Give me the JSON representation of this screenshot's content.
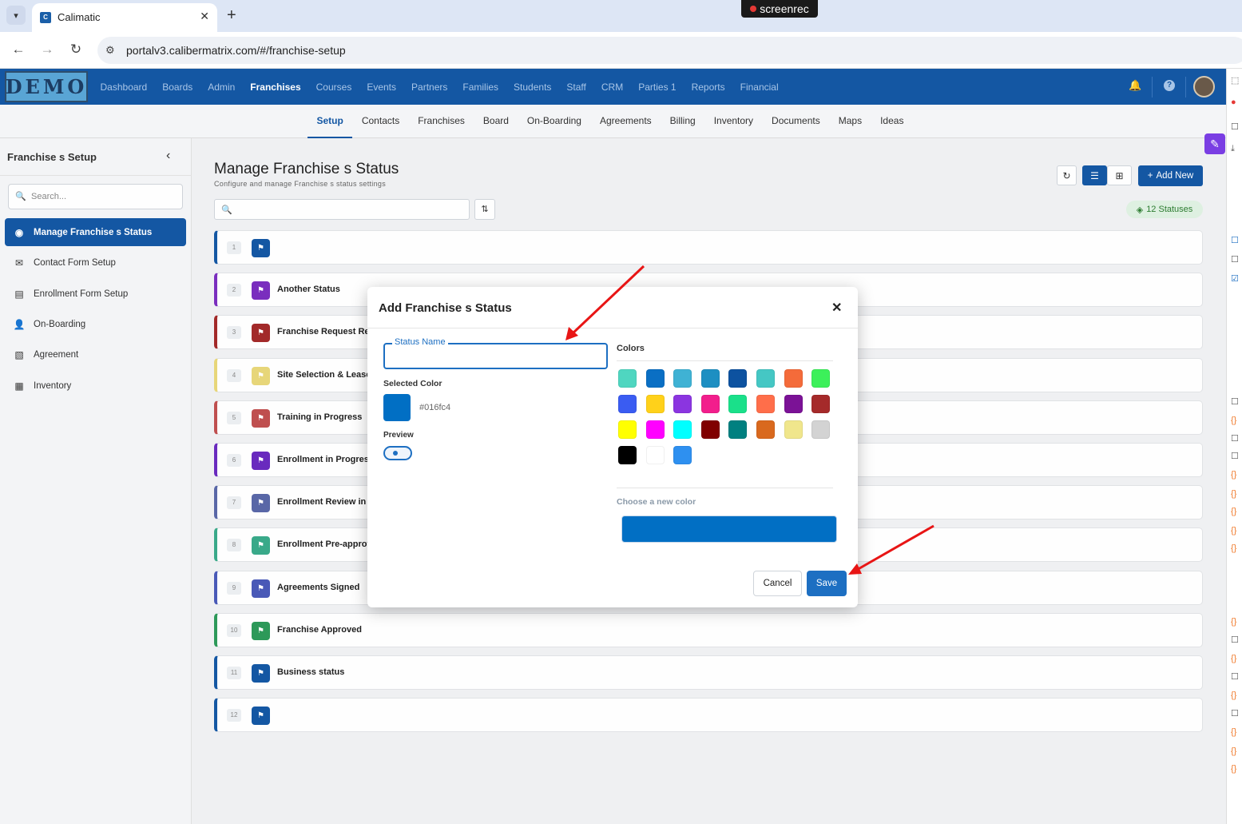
{
  "browser": {
    "tab_title": "Calimatic",
    "tab_close": "✕",
    "new_tab": "+",
    "url": "portalv3.calibermatrix.com/#/franchise-setup",
    "recorder": "screenrec"
  },
  "logo": "DEMO",
  "topnav": [
    "Dashboard",
    "Boards",
    "Admin",
    "Franchises",
    "Courses",
    "Events",
    "Partners",
    "Families",
    "Students",
    "Staff",
    "CRM",
    "Parties 1",
    "Reports",
    "Financial"
  ],
  "topnav_active": "Franchises",
  "subnav": [
    "Setup",
    "Contacts",
    "Franchises",
    "Board",
    "On-Boarding",
    "Agreements",
    "Billing",
    "Inventory",
    "Documents",
    "Maps",
    "Ideas"
  ],
  "subnav_active": "Setup",
  "sidebar": {
    "title": "Franchise s Setup",
    "search_placeholder": "Search...",
    "items": [
      {
        "label": "Manage Franchise s Status",
        "icon": "toggle-icon",
        "glyph": "◉"
      },
      {
        "label": "Contact Form Setup",
        "icon": "envelope-icon",
        "glyph": "✉"
      },
      {
        "label": "Enrollment Form Setup",
        "icon": "file-icon",
        "glyph": "▤"
      },
      {
        "label": "On-Boarding",
        "icon": "user-plus-icon",
        "glyph": "👤"
      },
      {
        "label": "Agreement",
        "icon": "file-chart-icon",
        "glyph": "▧"
      },
      {
        "label": "Inventory",
        "icon": "boxes-icon",
        "glyph": "▦"
      }
    ]
  },
  "page": {
    "title": "Manage Franchise s Status",
    "subtitle": "Configure and manage Franchise s status settings",
    "add_new": "Add New",
    "count_badge": "12 Statuses"
  },
  "statuses": [
    {
      "num": "1",
      "name": "",
      "color": "#1558a4"
    },
    {
      "num": "2",
      "name": "Another Status",
      "color": "#7b2fbf"
    },
    {
      "num": "3",
      "name": "Franchise Request Rec",
      "color": "#a32a2a"
    },
    {
      "num": "4",
      "name": "Site Selection & Lease",
      "color": "#e8d77a"
    },
    {
      "num": "5",
      "name": "Training in Progress",
      "color": "#c05050"
    },
    {
      "num": "6",
      "name": "Enrollment in Progress",
      "color": "#6a2bbf"
    },
    {
      "num": "7",
      "name": "Enrollment Review in F",
      "color": "#5a68a8"
    },
    {
      "num": "8",
      "name": "Enrollment Pre-approv",
      "color": "#3aaa8a"
    },
    {
      "num": "9",
      "name": "Agreements Signed",
      "color": "#4a5ab8"
    },
    {
      "num": "10",
      "name": "Franchise Approved",
      "color": "#2e9a5a"
    },
    {
      "num": "11",
      "name": "Business status",
      "color": "#1558a4"
    },
    {
      "num": "12",
      "name": "",
      "color": "#1558a4"
    }
  ],
  "modal": {
    "title": "Add Franchise s Status",
    "close": "✕",
    "status_name_label": "Status Name",
    "status_name_value": "",
    "selected_color_label": "Selected Color",
    "selected_color": "#016fc4",
    "preview_label": "Preview",
    "colors_label": "Colors",
    "palette": [
      "#4fd6c0",
      "#0a6fc4",
      "#3fb2d4",
      "#1d8fc2",
      "#0d52a0",
      "#45c7c4",
      "#f46b3a",
      "#3cf05a",
      "#3a5cf2",
      "#ffd11a",
      "#8b35e0",
      "#f21e8c",
      "#1ae08a",
      "#ff6e4a",
      "#7b1296",
      "#a52a2a",
      "#ffff00",
      "#ff00ff",
      "#00ffff",
      "#800000",
      "#008080",
      "#d9691e",
      "#f0e68c",
      "#d3d3d3",
      "#000000",
      "#ffffff",
      "#2e90f0"
    ],
    "choose_label": "Choose a new color",
    "cancel": "Cancel",
    "save": "Save"
  }
}
